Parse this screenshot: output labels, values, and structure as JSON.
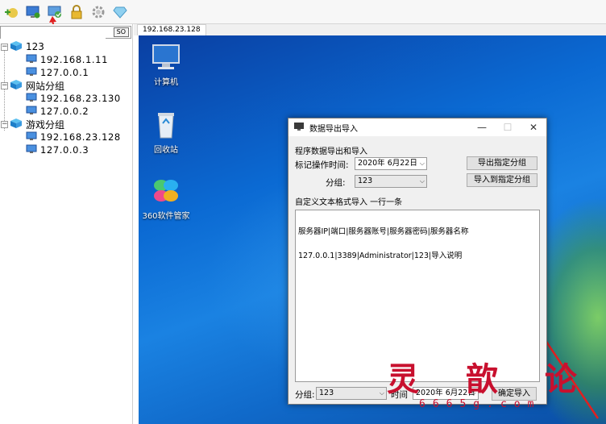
{
  "toolbar": {
    "buttons": [
      {
        "name": "add-server-icon"
      },
      {
        "name": "monitor-add-icon"
      },
      {
        "name": "import-export-icon"
      },
      {
        "name": "lock-icon"
      },
      {
        "name": "gear-icon"
      },
      {
        "name": "diamond-icon"
      }
    ]
  },
  "search": {
    "value": "",
    "button_label": "SO"
  },
  "tree": {
    "groups": [
      {
        "label": "123",
        "hosts": [
          "192.168.1.11",
          "127.0.0.1"
        ]
      },
      {
        "label": "网站分组",
        "hosts": [
          "192.168.23.130",
          "127.0.0.2"
        ]
      },
      {
        "label": "游戏分组",
        "hosts": [
          "192.168.23.128",
          "127.0.0.3"
        ]
      }
    ]
  },
  "tab": {
    "label": "192.168.23.128"
  },
  "desktop_icons": {
    "computer": "计算机",
    "recycle": "回收站",
    "manager": "360软件管家"
  },
  "dialog": {
    "title": "数据导出导入",
    "section1": "程序数据导出和导入",
    "time_label": "标记操作时间:",
    "date_value": "2020年 6月22日",
    "group_label": "分组:",
    "group_value": "123",
    "export_button": "导出指定分组",
    "import_button": "导入到指定分组",
    "section2": "自定义文本格式导入 一行一条",
    "text_lines": [
      "服务器IP|端口|服务器账号|服务器密码|服务器名称",
      "127.0.0.1|3389|Administrator|123|导入说明"
    ],
    "bottom_group_label": "分组:",
    "bottom_group_value": "123",
    "bottom_time_label": "时间",
    "bottom_date_value": "2020年 6月22日",
    "confirm_button": "确定导入"
  },
  "watermark": {
    "text": "灵 歆 论 坛",
    "url": "6665g.com"
  },
  "colors": {
    "accent_red": "#c8102e",
    "desktop_blue": "#0b6ad3"
  }
}
